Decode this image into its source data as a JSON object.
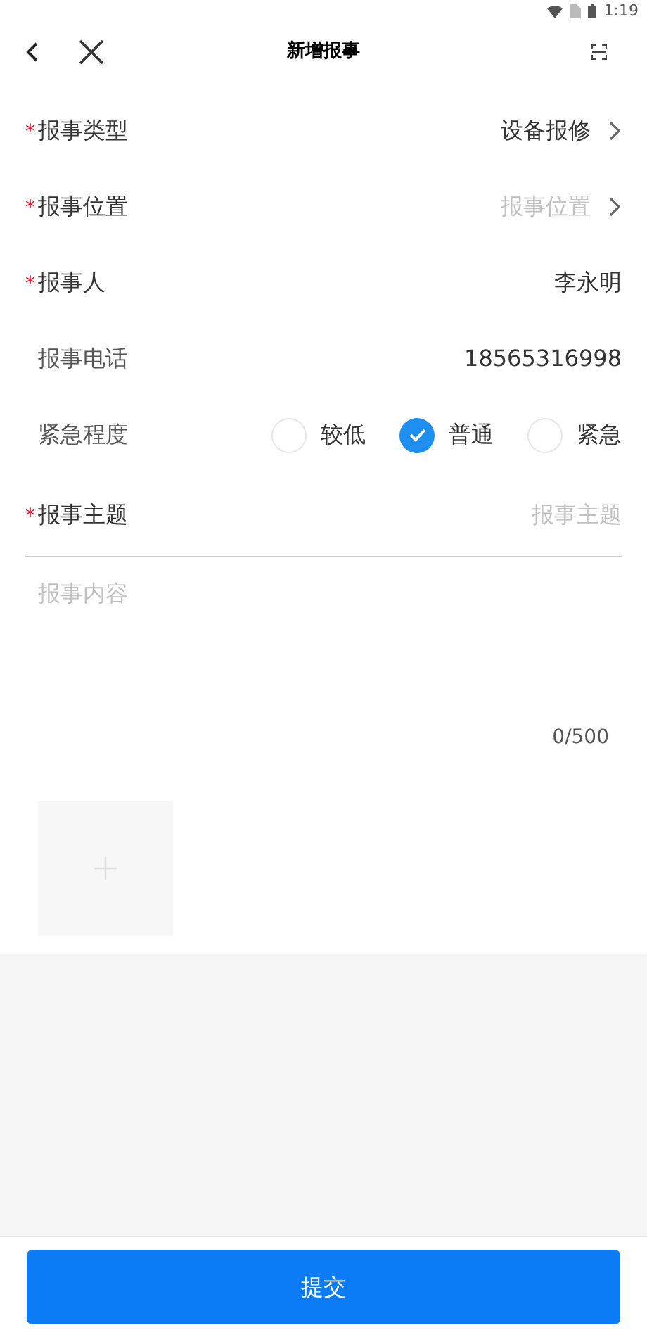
{
  "status_bar": {
    "time": "1:19"
  },
  "header": {
    "title": "新增报事"
  },
  "fields": [
    {
      "kind": "select",
      "label": "报事类型",
      "required_mark": "*",
      "value": "设备报修"
    },
    {
      "kind": "select",
      "label": "报事位置",
      "required_mark": "*",
      "placeholder": "报事位置"
    },
    {
      "kind": "text",
      "label": "报事人",
      "required_mark": "*",
      "value": "李永明"
    },
    {
      "kind": "text",
      "label": "报事电话",
      "value": "18565316998"
    },
    {
      "kind": "radio",
      "label": "紧急程度",
      "options": [
        {
          "label": "较低",
          "selected": false
        },
        {
          "label": "普通",
          "selected": true
        },
        {
          "label": "紧急",
          "selected": false
        }
      ]
    },
    {
      "kind": "input",
      "label": "报事主题",
      "required_mark": "*",
      "placeholder": "报事主题"
    }
  ],
  "content": {
    "placeholder": "报事内容",
    "counter": "0/500"
  },
  "submit": "提交"
}
